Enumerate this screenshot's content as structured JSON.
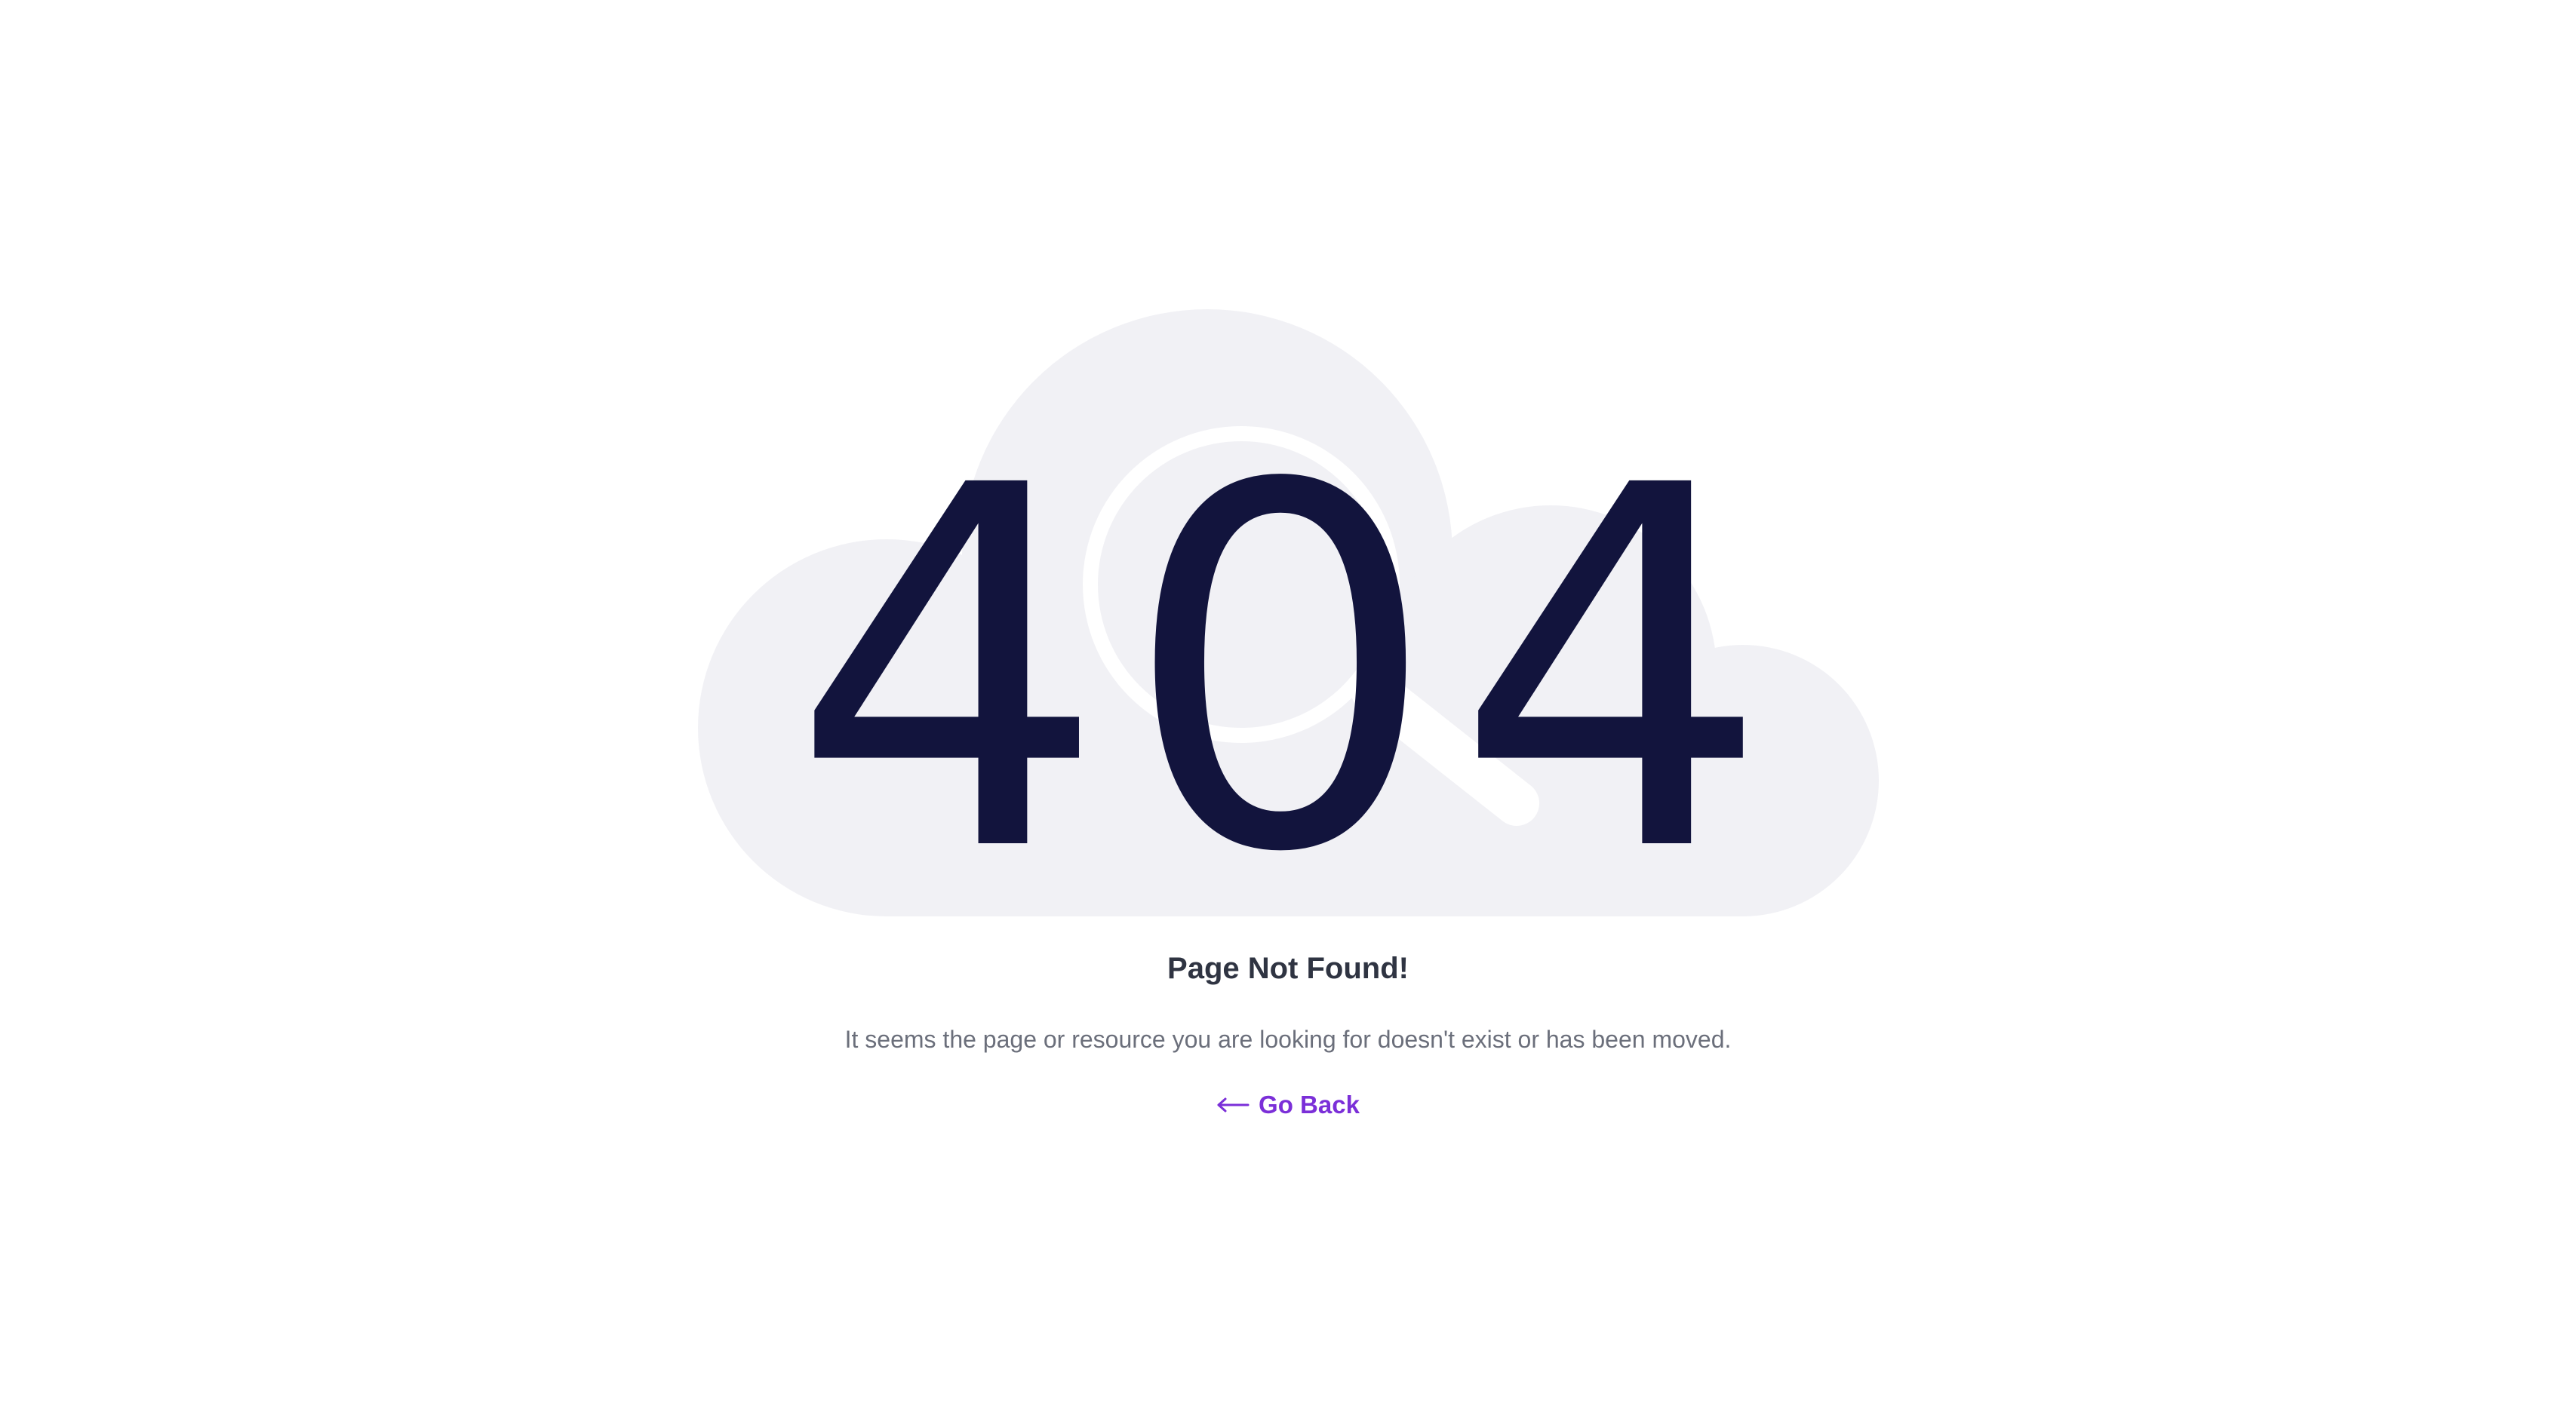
{
  "error": {
    "code": "404",
    "title": "Page Not Found!",
    "message": "It seems the page or resource you are looking for doesn't exist or has been moved."
  },
  "actions": {
    "go_back_label": "Go Back",
    "go_back_icon": "arrow-left-icon"
  },
  "illustration": {
    "name": "cloud-magnifier-illustration",
    "cloud_color": "#f1f1f5",
    "magnifier_color": "#ffffff"
  },
  "colors": {
    "code": "#12143d",
    "title": "#2f3442",
    "message": "#6b6f7b",
    "accent": "#7b2fd8",
    "background": "#ffffff"
  }
}
